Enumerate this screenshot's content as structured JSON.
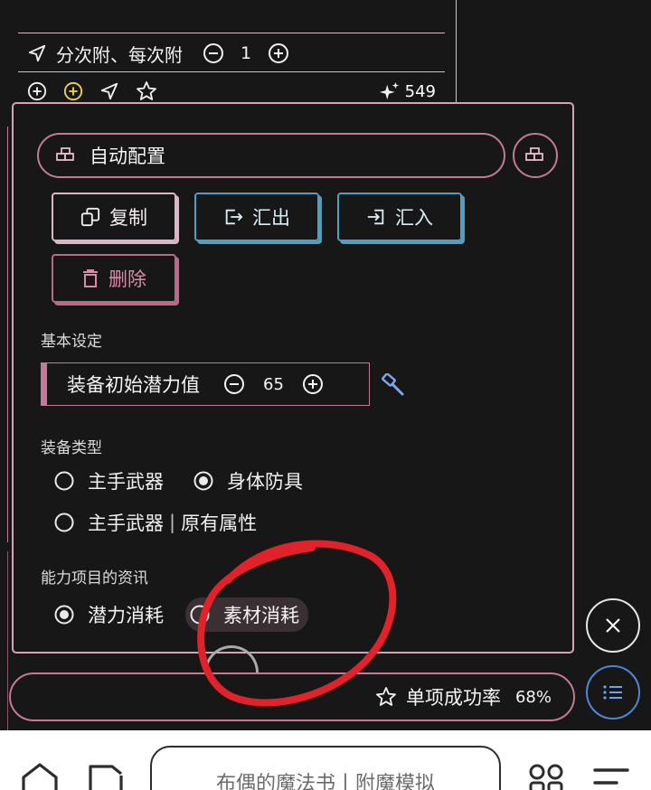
{
  "background": {
    "row1": {
      "text": "分次附、每次附",
      "count": "1"
    },
    "row2": {
      "count": "549"
    }
  },
  "popup": {
    "preset": {
      "label": "自动配置"
    },
    "buttons": {
      "copy": "复制",
      "export": "汇出",
      "import": "汇入",
      "delete": "删除"
    },
    "basic": {
      "title": "基本设定",
      "potential_label": "装备初始潜力值",
      "potential_value": "65"
    },
    "equip_type": {
      "title": "装备类型",
      "options": [
        "主手武器",
        "身体防具",
        "主手武器",
        "原有属性"
      ],
      "selected": "身体防具"
    },
    "ability_info": {
      "title": "能力项目的资讯",
      "options": [
        "潜力消耗",
        "素材消耗"
      ],
      "selected": "潜力消耗"
    }
  },
  "success": {
    "label": "单项成功率",
    "value": "68%"
  },
  "browser": {
    "url_text": "布偶的魔法书丨附魔模拟"
  },
  "colors": {
    "accent_pink": "#c27a98",
    "accent_blue": "#4f9fc3",
    "annotation_red": "#e0222a"
  }
}
